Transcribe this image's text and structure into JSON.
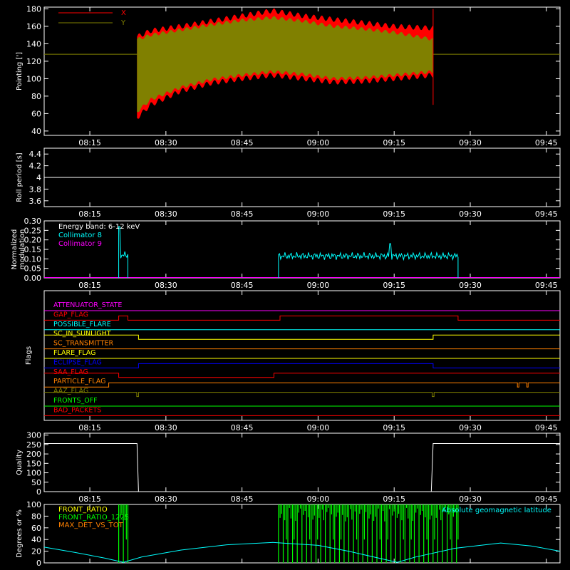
{
  "time_axis": {
    "ticks": [
      "08:15",
      "08:30",
      "08:45",
      "09:00",
      "09:15",
      "09:30",
      "09:45"
    ],
    "tick_hours": [
      8.25,
      8.5,
      8.75,
      9.0,
      9.25,
      9.5,
      9.75
    ],
    "range_hours": [
      8.1,
      9.795
    ]
  },
  "chart_data": [
    {
      "id": "pointing",
      "type": "area",
      "ylabel": "Pointing [']",
      "ylim": [
        35,
        182
      ],
      "yticks": [
        40,
        60,
        80,
        100,
        120,
        140,
        160,
        180
      ],
      "grid": false,
      "legend_position": "top-left",
      "baseline": 128,
      "active_window_hours": [
        8.405,
        9.378
      ],
      "series": [
        {
          "name": "X",
          "color": "#ff0000",
          "envelope": {
            "x": [
              8.405,
              8.45,
              8.55,
              8.65,
              8.75,
              8.85,
              8.95,
              9.05,
              9.15,
              9.25,
              9.378
            ],
            "upper": [
              148,
              155,
              160,
              166,
              172,
              178,
              172,
              168,
              164,
              160,
              158
            ],
            "lower": [
              55,
              70,
              86,
              95,
              100,
              104,
              100,
              96,
              97,
              100,
              104
            ]
          }
        },
        {
          "name": "Y",
          "color": "#808000",
          "envelope": {
            "x": [
              8.405,
              8.45,
              8.55,
              8.65,
              8.75,
              8.85,
              8.95,
              9.05,
              9.15,
              9.25,
              9.378
            ],
            "upper": [
              145,
              150,
              156,
              162,
              167,
              170,
              166,
              160,
              157,
              153,
              145
            ],
            "lower": [
              62,
              76,
              90,
              99,
              104,
              108,
              105,
              100,
              101,
              104,
              108
            ]
          }
        }
      ]
    },
    {
      "id": "roll",
      "type": "line",
      "ylabel": "Roll period [s]",
      "ylim": [
        3.5,
        4.5
      ],
      "yticks": [
        3.6,
        3.8,
        4.0,
        4.2,
        4.4
      ],
      "series": [
        {
          "name": "",
          "color": "#ffffff",
          "x": [
            8.1,
            9.795
          ],
          "y": [
            4.0,
            4.0
          ]
        }
      ]
    },
    {
      "id": "modulation",
      "type": "line",
      "ylabel": "Normalized modulation",
      "ylim": [
        0,
        0.3
      ],
      "yticks": [
        "0.00",
        "0.05",
        "0.10",
        "0.15",
        "0.20",
        "0.25",
        "0.30"
      ],
      "legend_position": "top-left",
      "legend_title": "Energy band: 6-12 keV",
      "series": [
        {
          "name": "Collimator 8",
          "color": "#00ffff",
          "segments": [
            {
              "x": [
                8.345,
                8.375
              ],
              "base": 0.0,
              "level": 0.12,
              "spike": {
                "x": 8.347,
                "y": 0.27
              }
            },
            {
              "x": [
                8.87,
                9.46
              ],
              "base": 0.0,
              "level": 0.115,
              "spike": {
                "x": 9.236,
                "y": 0.18
              }
            }
          ]
        },
        {
          "name": "Collimator 9",
          "color": "#ff00ff",
          "x": [
            8.1,
            9.795
          ],
          "y": [
            0,
            0
          ]
        }
      ]
    },
    {
      "id": "flags",
      "type": "line",
      "ylabel": "Flags",
      "series": [
        {
          "name": "ATTENUATOR_STATE",
          "color": "#ff00ff",
          "transitions": []
        },
        {
          "name": "GAP_FLAG",
          "color": "#ff0000",
          "transitions": [
            [
              8.345,
              1
            ],
            [
              8.375,
              0
            ],
            [
              8.875,
              1
            ],
            [
              9.46,
              0
            ]
          ]
        },
        {
          "name": "POSSIBLE_FLARE",
          "color": "#00ffff",
          "transitions": []
        },
        {
          "name": "SC_IN_SUNLIGHT",
          "color": "#ffff00",
          "transitions": [
            [
              8.41,
              0
            ],
            [
              9.378,
              1
            ]
          ]
        },
        {
          "name": "SC_TRANSMITTER",
          "color": "#ff8000",
          "transitions": []
        },
        {
          "name": "FLARE_FLAG",
          "color": "#ffff00",
          "transitions": []
        },
        {
          "name": "ECLIPSE_FLAG",
          "color": "#0000ff",
          "transitions": [
            [
              8.41,
              1
            ],
            [
              9.378,
              0
            ]
          ]
        },
        {
          "name": "SAA_FLAG",
          "color": "#ff0000",
          "transitions": [
            [
              8.345,
              0
            ],
            [
              8.855,
              1
            ]
          ]
        },
        {
          "name": "PARTICLE_FLAG",
          "color": "#ff8000",
          "transitions": [
            [
              8.312,
              1
            ],
            [
              9.655,
              0
            ],
            [
              9.66,
              1
            ],
            [
              9.686,
              0
            ],
            [
              9.69,
              1
            ]
          ]
        },
        {
          "name": "AAZ_FLAG",
          "color": "#808000",
          "transitions": [
            [
              8.404,
              0
            ],
            [
              8.41,
              1
            ],
            [
              9.375,
              0
            ],
            [
              9.381,
              1
            ]
          ]
        },
        {
          "name": "FRONTS_OFF",
          "color": "#00ff00",
          "transitions": []
        },
        {
          "name": "BAD_PACKETS",
          "color": "#ff0000",
          "transitions": []
        }
      ]
    },
    {
      "id": "quality",
      "type": "line",
      "ylabel": "Quality",
      "ylim": [
        0,
        310
      ],
      "yticks": [
        0,
        50,
        100,
        150,
        200,
        250,
        300
      ],
      "series": [
        {
          "name": "",
          "color": "#ffffff",
          "x": [
            8.1,
            8.405,
            8.41,
            9.372,
            9.378,
            9.795
          ],
          "y": [
            255,
            255,
            0,
            0,
            255,
            255
          ]
        }
      ]
    },
    {
      "id": "degrees",
      "type": "line",
      "ylabel": "Degrees or %",
      "ylim": [
        0,
        100
      ],
      "yticks": [
        0,
        20,
        40,
        60,
        80,
        100
      ],
      "legend_position": "top-left",
      "series": [
        {
          "name": "FRONT_RATIO",
          "color": "#ffff00",
          "bursts": []
        },
        {
          "name": "FRONT_RATIO_1225",
          "color": "#00ff00",
          "bursts": [
            [
              8.345,
              8.375
            ],
            [
              8.87,
              9.46
            ]
          ]
        },
        {
          "name": "MAX_DET_VS_TOT",
          "color": "#ff8000",
          "bursts": []
        },
        {
          "name": "Absolute geomagnetic latitude",
          "color": "#00ffff",
          "x": [
            8.1,
            8.2,
            8.3,
            8.36,
            8.42,
            8.55,
            8.7,
            8.85,
            9.0,
            9.1,
            9.2,
            9.26,
            9.32,
            9.45,
            9.6,
            9.7,
            9.795
          ],
          "y": [
            27,
            18,
            8,
            1,
            10,
            22,
            31,
            35,
            30,
            20,
            8,
            1,
            10,
            25,
            34,
            29,
            20
          ]
        }
      ]
    }
  ]
}
